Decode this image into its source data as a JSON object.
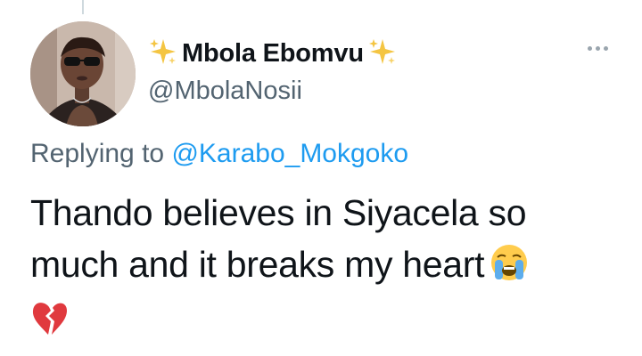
{
  "tweet": {
    "display_name": "Mbola Ebomvu",
    "handle": "@MbolaNosii",
    "reply_prefix": "Replying to",
    "reply_to": "@Karabo_Mokgoko",
    "text_line1": "Thando believes in Siyacela so",
    "text_line2": "much and it breaks my heart",
    "name_decoration_icon": "sparkles-icon",
    "emojis": [
      "loudly-crying-face-icon",
      "broken-heart-icon"
    ]
  },
  "colors": {
    "text": "#0f1419",
    "secondary": "#536471",
    "link": "#1d9bf0",
    "sparkle": "#f4c542",
    "broken_heart": "#e0393e",
    "crying_face": "#ffcc4d"
  }
}
